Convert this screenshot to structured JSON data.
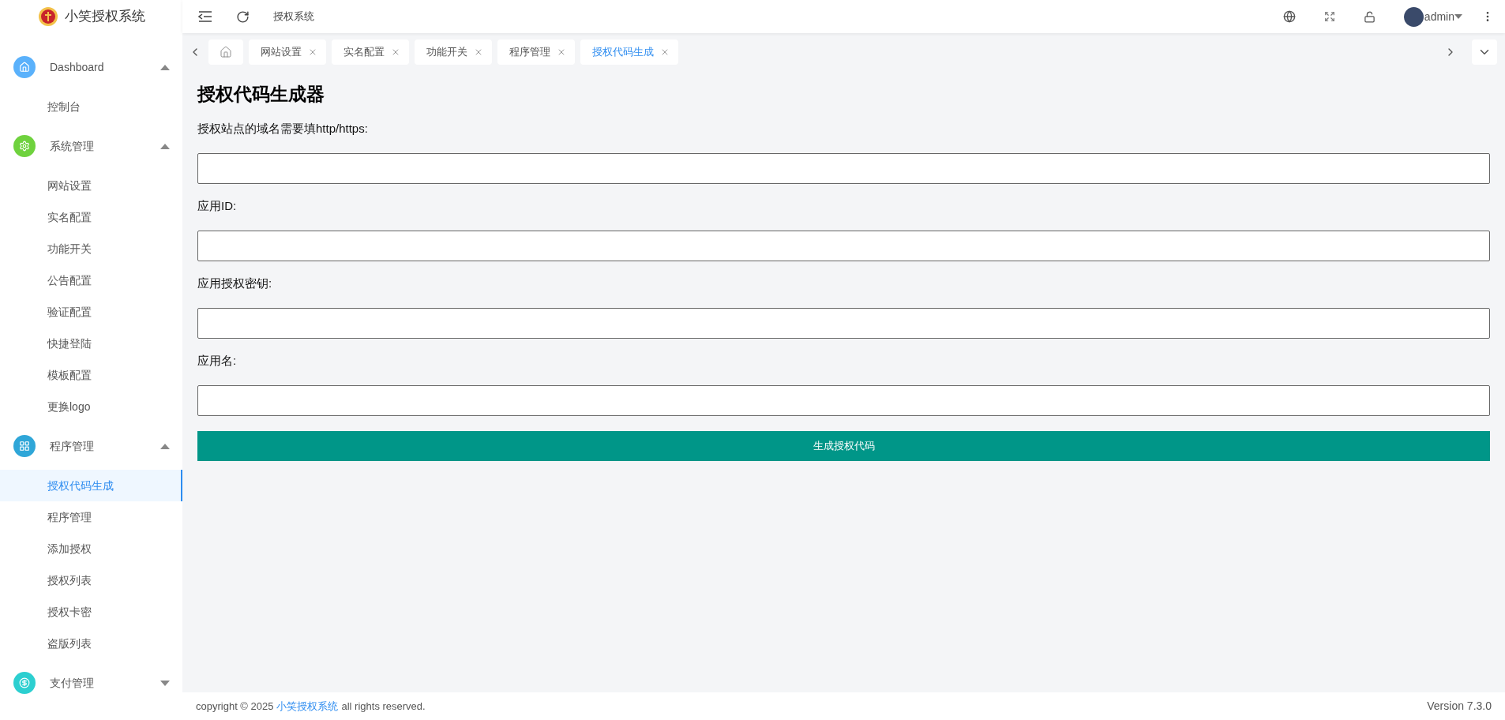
{
  "brand": {
    "name": "小笑授权系统"
  },
  "header": {
    "breadcrumb": "授权系统",
    "user": "admin"
  },
  "sidebar": {
    "groups": [
      {
        "label": "Dashboard",
        "color": "#5ab1fb",
        "expanded": true,
        "items": [
          {
            "label": "控制台",
            "selected": false
          }
        ]
      },
      {
        "label": "系统管理",
        "color": "#6fd23e",
        "expanded": true,
        "items": [
          {
            "label": "网站设置",
            "selected": false
          },
          {
            "label": "实名配置",
            "selected": false
          },
          {
            "label": "功能开关",
            "selected": false
          },
          {
            "label": "公告配置",
            "selected": false
          },
          {
            "label": "验证配置",
            "selected": false
          },
          {
            "label": "快捷登陆",
            "selected": false
          },
          {
            "label": "模板配置",
            "selected": false
          },
          {
            "label": "更换logo",
            "selected": false
          }
        ]
      },
      {
        "label": "程序管理",
        "color": "#2fa6d8",
        "expanded": true,
        "items": [
          {
            "label": "授权代码生成",
            "selected": true
          },
          {
            "label": "程序管理",
            "selected": false
          },
          {
            "label": "添加授权",
            "selected": false
          },
          {
            "label": "授权列表",
            "selected": false
          },
          {
            "label": "授权卡密",
            "selected": false
          },
          {
            "label": "盗版列表",
            "selected": false
          }
        ]
      },
      {
        "label": "支付管理",
        "color": "#2ccfd0",
        "expanded": false
      }
    ]
  },
  "tabs": [
    {
      "label": "网站设置",
      "selected": false
    },
    {
      "label": "实名配置",
      "selected": false
    },
    {
      "label": "功能开关",
      "selected": false
    },
    {
      "label": "程序管理",
      "selected": false
    },
    {
      "label": "授权代码生成",
      "selected": true
    }
  ],
  "form": {
    "title": "授权代码生成器",
    "fields": [
      {
        "label": "授权站点的域名需要填http/https:"
      },
      {
        "label": "应用ID:"
      },
      {
        "label": "应用授权密钥:"
      },
      {
        "label": "应用名:"
      }
    ],
    "submit": "生成授权代码"
  },
  "footer": {
    "prefix": "copyright © 2025",
    "link": "小笑授权系统",
    "suffix": "all rights reserved.",
    "version": "Version 7.3.0"
  }
}
